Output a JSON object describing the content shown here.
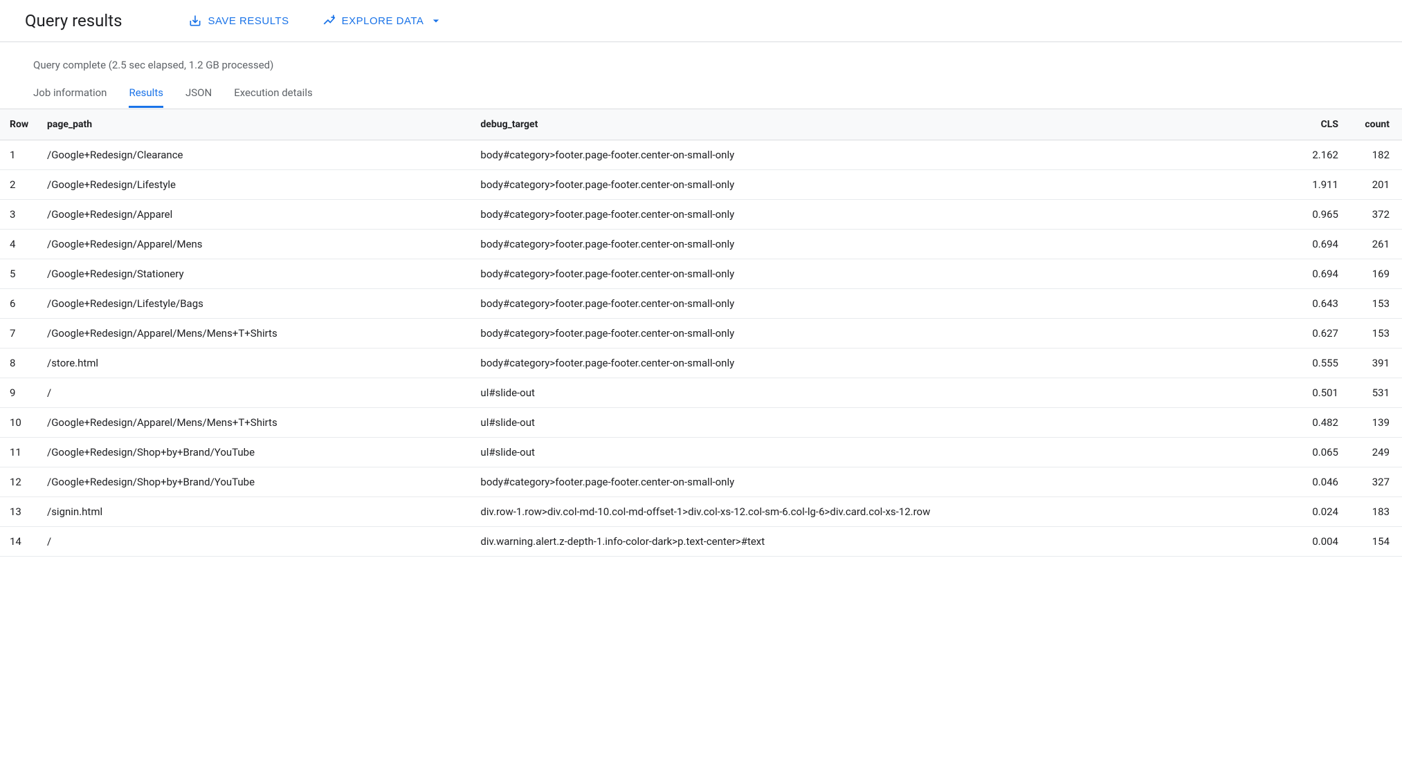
{
  "header": {
    "title": "Query results",
    "save_results_label": "SAVE RESULTS",
    "explore_data_label": "EXPLORE DATA"
  },
  "status": "Query complete (2.5 sec elapsed, 1.2 GB processed)",
  "tabs": {
    "job_information": "Job information",
    "results": "Results",
    "json": "JSON",
    "execution_details": "Execution details"
  },
  "table": {
    "columns": {
      "row": "Row",
      "page_path": "page_path",
      "debug_target": "debug_target",
      "cls": "CLS",
      "count": "count"
    },
    "rows": [
      {
        "row": "1",
        "page_path": "/Google+Redesign/Clearance",
        "debug_target": "body#category>footer.page-footer.center-on-small-only",
        "cls": "2.162",
        "count": "182"
      },
      {
        "row": "2",
        "page_path": "/Google+Redesign/Lifestyle",
        "debug_target": "body#category>footer.page-footer.center-on-small-only",
        "cls": "1.911",
        "count": "201"
      },
      {
        "row": "3",
        "page_path": "/Google+Redesign/Apparel",
        "debug_target": "body#category>footer.page-footer.center-on-small-only",
        "cls": "0.965",
        "count": "372"
      },
      {
        "row": "4",
        "page_path": "/Google+Redesign/Apparel/Mens",
        "debug_target": "body#category>footer.page-footer.center-on-small-only",
        "cls": "0.694",
        "count": "261"
      },
      {
        "row": "5",
        "page_path": "/Google+Redesign/Stationery",
        "debug_target": "body#category>footer.page-footer.center-on-small-only",
        "cls": "0.694",
        "count": "169"
      },
      {
        "row": "6",
        "page_path": "/Google+Redesign/Lifestyle/Bags",
        "debug_target": "body#category>footer.page-footer.center-on-small-only",
        "cls": "0.643",
        "count": "153"
      },
      {
        "row": "7",
        "page_path": "/Google+Redesign/Apparel/Mens/Mens+T+Shirts",
        "debug_target": "body#category>footer.page-footer.center-on-small-only",
        "cls": "0.627",
        "count": "153"
      },
      {
        "row": "8",
        "page_path": "/store.html",
        "debug_target": "body#category>footer.page-footer.center-on-small-only",
        "cls": "0.555",
        "count": "391"
      },
      {
        "row": "9",
        "page_path": "/",
        "debug_target": "ul#slide-out",
        "cls": "0.501",
        "count": "531"
      },
      {
        "row": "10",
        "page_path": "/Google+Redesign/Apparel/Mens/Mens+T+Shirts",
        "debug_target": "ul#slide-out",
        "cls": "0.482",
        "count": "139"
      },
      {
        "row": "11",
        "page_path": "/Google+Redesign/Shop+by+Brand/YouTube",
        "debug_target": "ul#slide-out",
        "cls": "0.065",
        "count": "249"
      },
      {
        "row": "12",
        "page_path": "/Google+Redesign/Shop+by+Brand/YouTube",
        "debug_target": "body#category>footer.page-footer.center-on-small-only",
        "cls": "0.046",
        "count": "327"
      },
      {
        "row": "13",
        "page_path": "/signin.html",
        "debug_target": "div.row-1.row>div.col-md-10.col-md-offset-1>div.col-xs-12.col-sm-6.col-lg-6>div.card.col-xs-12.row",
        "cls": "0.024",
        "count": "183"
      },
      {
        "row": "14",
        "page_path": "/",
        "debug_target": "div.warning.alert.z-depth-1.info-color-dark>p.text-center>#text",
        "cls": "0.004",
        "count": "154"
      }
    ]
  }
}
